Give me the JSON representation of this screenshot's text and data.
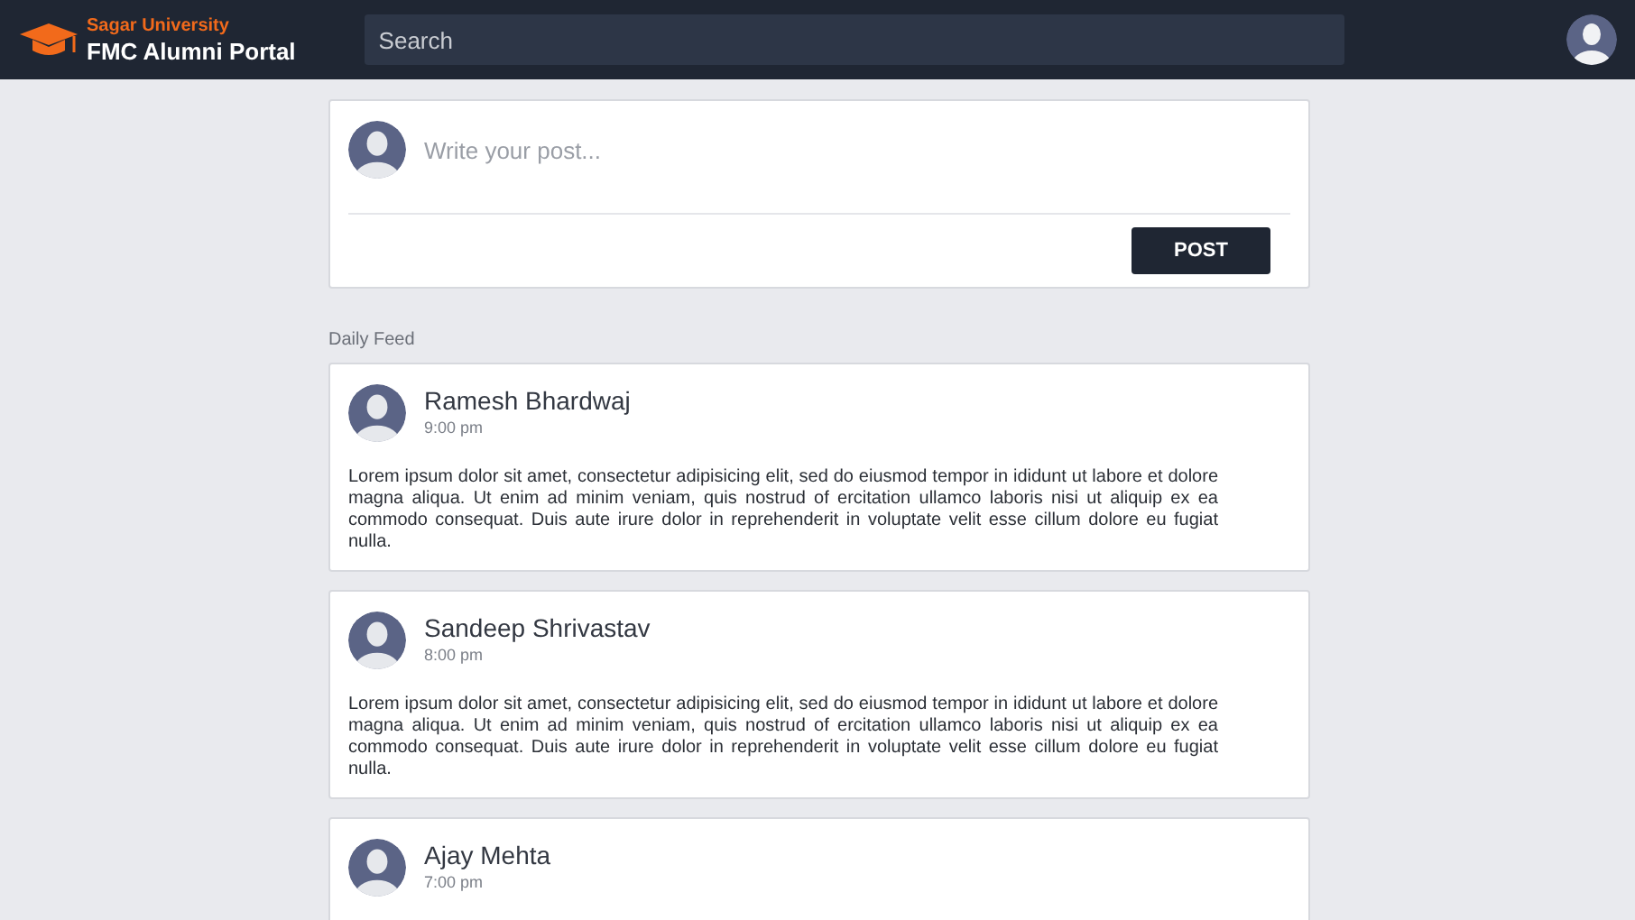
{
  "header": {
    "logo_top": "Sagar University",
    "logo_bottom": "FMC Alumni Portal",
    "search": {
      "placeholder": "Search"
    }
  },
  "composer": {
    "placeholder": "Write your post...",
    "button": "POST"
  },
  "feed_title": "Daily Feed",
  "posts": [
    {
      "author": "Ramesh Bhardwaj",
      "time": "9:00 pm",
      "body": "Lorem ipsum dolor sit amet, consectetur adipisicing elit, sed do eiusmod tempor in ididunt ut labore et dolore magna aliqua. Ut enim ad minim veniam, quis nostrud of ercitation ullamco laboris nisi ut aliquip ex ea commodo consequat. Duis aute irure dolor in reprehenderit in voluptate velit esse cillum dolore eu fugiat nulla."
    },
    {
      "author": "Sandeep Shrivastav",
      "time": "8:00 pm",
      "body": "Lorem ipsum dolor sit amet, consectetur adipisicing elit, sed do eiusmod tempor in ididunt ut labore et dolore magna aliqua. Ut enim ad minim veniam, quis nostrud of ercitation ullamco laboris nisi ut aliquip ex ea commodo consequat. Duis aute irure dolor in reprehenderit in voluptate velit esse cillum dolore eu fugiat nulla."
    },
    {
      "author": "Ajay Mehta",
      "time": "7:00 pm"
    }
  ]
}
